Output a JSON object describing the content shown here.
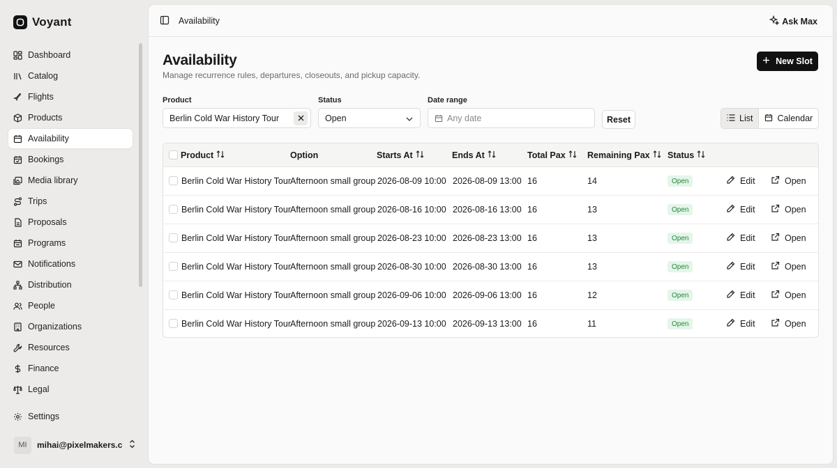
{
  "brand": {
    "name": "Voyant"
  },
  "sidebar": {
    "items": [
      {
        "label": "Dashboard",
        "icon": "dashboard-icon"
      },
      {
        "label": "Catalog",
        "icon": "library-icon"
      },
      {
        "label": "Flights",
        "icon": "plane-icon"
      },
      {
        "label": "Products",
        "icon": "package-icon"
      },
      {
        "label": "Availability",
        "icon": "calendar-icon",
        "active": true
      },
      {
        "label": "Bookings",
        "icon": "calendar-check-icon"
      },
      {
        "label": "Media library",
        "icon": "images-icon"
      },
      {
        "label": "Trips",
        "icon": "route-icon"
      },
      {
        "label": "Proposals",
        "icon": "file-text-icon"
      },
      {
        "label": "Programs",
        "icon": "calendar-range-icon"
      },
      {
        "label": "Notifications",
        "icon": "mail-icon"
      },
      {
        "label": "Distribution",
        "icon": "network-icon"
      },
      {
        "label": "People",
        "icon": "users-icon"
      },
      {
        "label": "Organizations",
        "icon": "building-icon"
      },
      {
        "label": "Resources",
        "icon": "wrench-icon"
      },
      {
        "label": "Finance",
        "icon": "dollar-icon"
      },
      {
        "label": "Legal",
        "icon": "scale-icon"
      }
    ],
    "settings_label": "Settings",
    "user": {
      "initials": "MI",
      "email": "mihai@pixelmakers.c..."
    }
  },
  "topbar": {
    "breadcrumb": "Availability",
    "ask_label": "Ask Max"
  },
  "page": {
    "title": "Availability",
    "subtitle": "Manage recurrence rules, departures, closeouts, and pickup capacity.",
    "new_slot_label": "New Slot"
  },
  "filters": {
    "product_label": "Product",
    "product_value": "Berlin Cold War History Tour",
    "status_label": "Status",
    "status_value": "Open",
    "date_label": "Date range",
    "date_placeholder": "Any date",
    "reset_label": "Reset"
  },
  "view": {
    "list_label": "List",
    "calendar_label": "Calendar",
    "active": "list"
  },
  "table": {
    "columns": [
      {
        "label": "Product",
        "sortable": true
      },
      {
        "label": "Option",
        "sortable": false
      },
      {
        "label": "Starts At",
        "sortable": true
      },
      {
        "label": "Ends At",
        "sortable": true
      },
      {
        "label": "Total Pax",
        "sortable": true
      },
      {
        "label": "Remaining Pax",
        "sortable": true
      },
      {
        "label": "Status",
        "sortable": true
      }
    ],
    "edit_label": "Edit",
    "open_label": "Open",
    "rows": [
      {
        "product": "Berlin Cold War History Tour",
        "option": "Afternoon small group",
        "starts": "2026-08-09 10:00",
        "ends": "2026-08-09 13:00",
        "total": "16",
        "remaining": "14",
        "status": "Open"
      },
      {
        "product": "Berlin Cold War History Tour",
        "option": "Afternoon small group",
        "starts": "2026-08-16 10:00",
        "ends": "2026-08-16 13:00",
        "total": "16",
        "remaining": "13",
        "status": "Open"
      },
      {
        "product": "Berlin Cold War History Tour",
        "option": "Afternoon small group",
        "starts": "2026-08-23 10:00",
        "ends": "2026-08-23 13:00",
        "total": "16",
        "remaining": "13",
        "status": "Open"
      },
      {
        "product": "Berlin Cold War History Tour",
        "option": "Afternoon small group",
        "starts": "2026-08-30 10:00",
        "ends": "2026-08-30 13:00",
        "total": "16",
        "remaining": "13",
        "status": "Open"
      },
      {
        "product": "Berlin Cold War History Tour",
        "option": "Afternoon small group",
        "starts": "2026-09-06 10:00",
        "ends": "2026-09-06 13:00",
        "total": "16",
        "remaining": "12",
        "status": "Open"
      },
      {
        "product": "Berlin Cold War History Tour",
        "option": "Afternoon small group",
        "starts": "2026-09-13 10:00",
        "ends": "2026-09-13 13:00",
        "total": "16",
        "remaining": "11",
        "status": "Open"
      }
    ]
  },
  "colors": {
    "accent": "#111111",
    "status_open_bg": "#e5f5e9",
    "status_open_text": "#1f8a3b"
  }
}
